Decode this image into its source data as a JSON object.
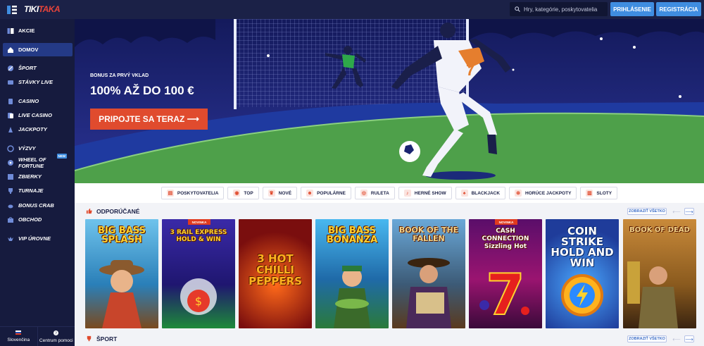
{
  "header": {
    "logo_left": "TIKI",
    "logo_right": "TAKA",
    "search_placeholder": "Hry, kategórie, poskytovatelia",
    "login_label": "PRIHLÁSENIE",
    "register_label": "REGISTRÁCIA"
  },
  "sidebar": {
    "items": [
      {
        "label": "AKCIE",
        "icon": "promotions-icon"
      },
      {
        "label": "DOMOV",
        "icon": "home-icon",
        "active": true
      },
      {
        "label": "ŠPORT",
        "icon": "sports-ball-icon"
      },
      {
        "label": "STÁVKY LIVE",
        "icon": "live-bets-icon"
      },
      {
        "label": "CASINO",
        "icon": "casino-icon"
      },
      {
        "label": "LIVE CASINO",
        "icon": "live-casino-icon"
      },
      {
        "label": "JACKPOTY",
        "icon": "jackpot-icon"
      },
      {
        "label": "VÝZVY",
        "icon": "challenges-icon"
      },
      {
        "label": "WHEEL OF FORTUNE",
        "icon": "wheel-icon",
        "badge": "NEW"
      },
      {
        "label": "ZBIERKY",
        "icon": "collections-icon"
      },
      {
        "label": "TURNAJE",
        "icon": "trophy-icon"
      },
      {
        "label": "BONUS CRAB",
        "icon": "crab-icon"
      },
      {
        "label": "OBCHOD",
        "icon": "shop-icon"
      },
      {
        "label": "VIP ÚROVNE",
        "icon": "vip-icon"
      }
    ],
    "footer": {
      "language": "Slovenčina",
      "help": "Centrum pomoci"
    }
  },
  "hero": {
    "subtitle": "BONUS ZA PRVÝ VKLAD",
    "title": "100% AŽ DO 100 €",
    "cta": "PRIPOJTE SA TERAZ ⟶",
    "player_number": "7"
  },
  "categories": [
    {
      "label": "POSKYTOVATELIA",
      "icon": "providers-icon"
    },
    {
      "label": "TOP",
      "icon": "top-icon"
    },
    {
      "label": "NOVÉ",
      "icon": "new-icon"
    },
    {
      "label": "POPULÁRNE",
      "icon": "popular-icon"
    },
    {
      "label": "RULETA",
      "icon": "roulette-icon"
    },
    {
      "label": "HERNÉ SHOW",
      "icon": "game-show-icon"
    },
    {
      "label": "BLACKJACK",
      "icon": "blackjack-icon"
    },
    {
      "label": "HORÚCE JACKPOTY",
      "icon": "hot-jackpot-icon"
    },
    {
      "label": "SLOTY",
      "icon": "slots-icon"
    }
  ],
  "sections": {
    "recommended": {
      "title": "ODPORÚČANÉ",
      "show_all": "ZOBRAZIŤ VŠETKO"
    },
    "sport": {
      "title": "ŠPORT",
      "show_all": "ZOBRAZIŤ VŠETKO"
    }
  },
  "games": [
    {
      "name": "BIG BASS SPLASH",
      "ribbon": "",
      "bg": "#3ea3d8"
    },
    {
      "name": "3 RAIL EXPRESS HOLD & WIN",
      "ribbon": "NOVINKA",
      "bg": "#2a1f8a"
    },
    {
      "name": "3 HOT CHILLI PEPPERS",
      "ribbon": "",
      "bg": "#7a0e0e"
    },
    {
      "name": "BIG BASS BONANZA",
      "ribbon": "",
      "bg": "#1f6aa8"
    },
    {
      "name": "BOOK OF THE FALLEN",
      "ribbon": "",
      "bg": "#3c5a76"
    },
    {
      "name": "CASH CONNECTION Sizzling Hot",
      "ribbon": "NOVINKA",
      "bg": "#7a1460"
    },
    {
      "name": "COIN STRIKE HOLD AND WIN",
      "ribbon": "",
      "bg": "#1f5cc8"
    },
    {
      "name": "BOOK OF DEAD",
      "ribbon": "",
      "bg": "#8a5a1e"
    }
  ]
}
